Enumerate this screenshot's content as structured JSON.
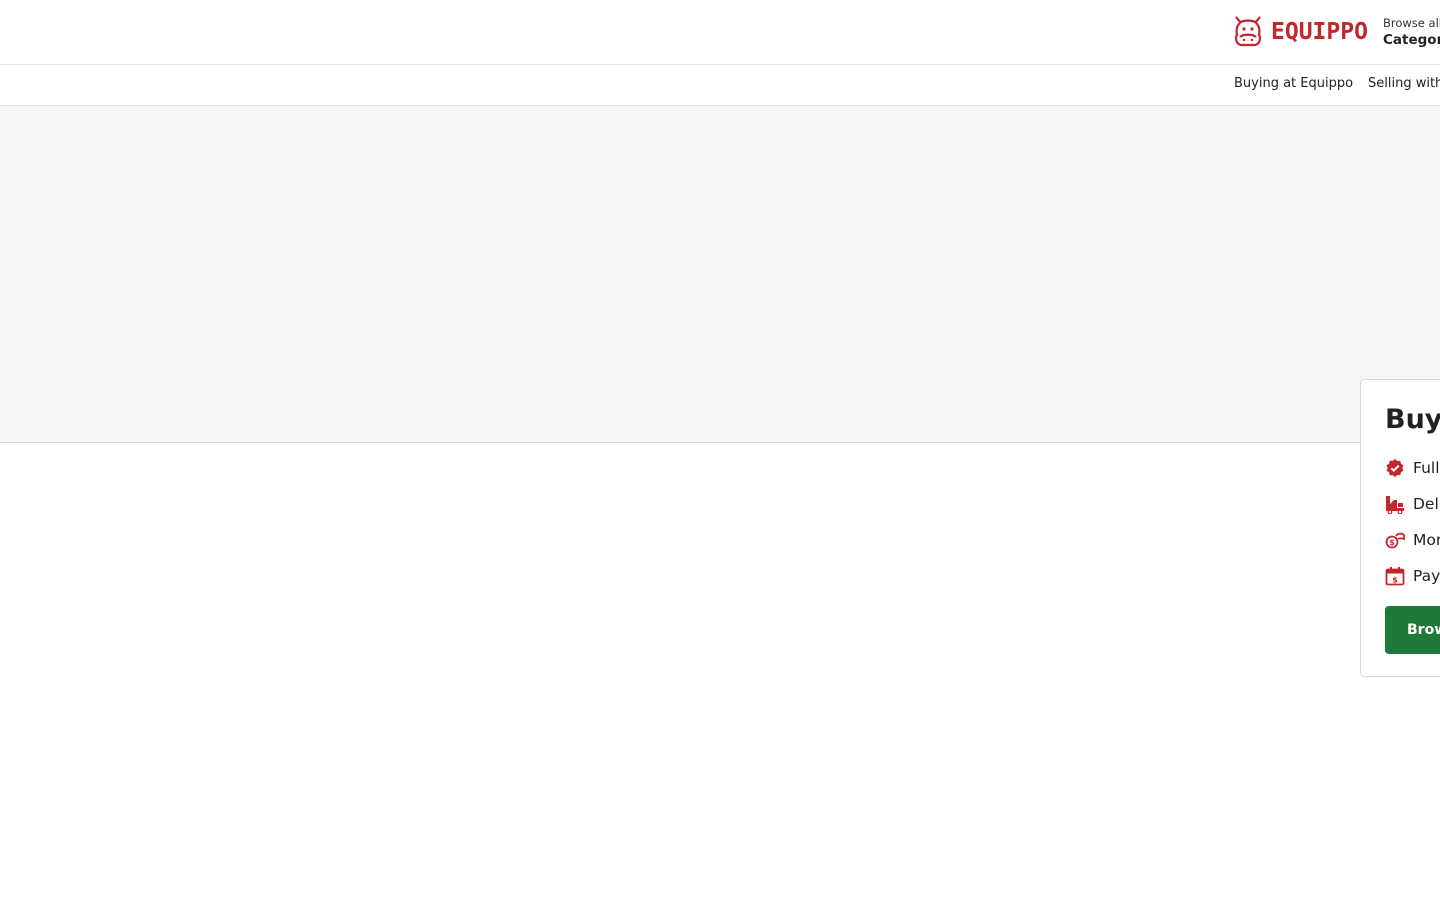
{
  "brand": {
    "name": "EQUIPPO",
    "color": "#c2272d"
  },
  "header": {
    "browse_small": "Browse all",
    "browse_big": "Categori"
  },
  "subnav": {
    "links": [
      "Buying at Equippo",
      "Selling with"
    ]
  },
  "card": {
    "title": "Buy",
    "features": [
      {
        "icon": "verified-badge-icon",
        "text": "Fully"
      },
      {
        "icon": "truck-icon",
        "text": "Deli"
      },
      {
        "icon": "money-hand-icon",
        "text": "Mor"
      },
      {
        "icon": "calendar-dollar-icon",
        "text": "Pay"
      }
    ],
    "button_label": "Brow",
    "button_color": "#1f7a3a"
  }
}
